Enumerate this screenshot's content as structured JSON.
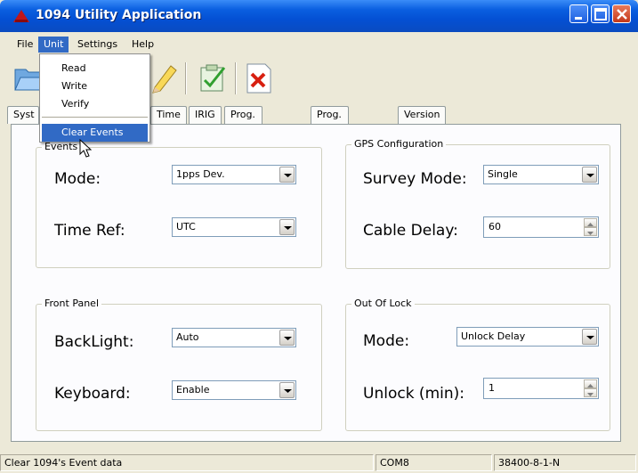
{
  "window": {
    "title": "1094 Utility Application"
  },
  "menubar": [
    "File",
    "Unit",
    "Settings",
    "Help"
  ],
  "unit_menu": {
    "items": [
      "Read",
      "Write",
      "Verify"
    ],
    "clear_events": "Clear Events"
  },
  "tabs": [
    "Syst",
    "Time",
    "IRIG",
    "Prog. Pulse A",
    "Prog. Pulse B",
    "Version"
  ],
  "events_group": {
    "title": "Events",
    "mode_label": "Mode:",
    "mode_value": "1pps Dev.",
    "timeref_label": "Time Ref:",
    "timeref_value": "UTC"
  },
  "gps_group": {
    "title": "GPS Configuration",
    "survey_label": "Survey Mode:",
    "survey_value": "Single",
    "cable_label": "Cable Delay:",
    "cable_value": "60"
  },
  "front_panel": {
    "title": "Front Panel",
    "backlight_label": "BackLight:",
    "backlight_value": "Auto",
    "keyboard_label": "Keyboard:",
    "keyboard_value": "Enable"
  },
  "out_of_lock": {
    "title": "Out Of Lock",
    "mode_label": "Mode:",
    "mode_value": "Unlock Delay",
    "unlock_label": "Unlock (min):",
    "unlock_value": "1"
  },
  "statusbar": {
    "message": "Clear 1094's Event data",
    "port": "COM8",
    "settings": "38400-8-1-N"
  }
}
